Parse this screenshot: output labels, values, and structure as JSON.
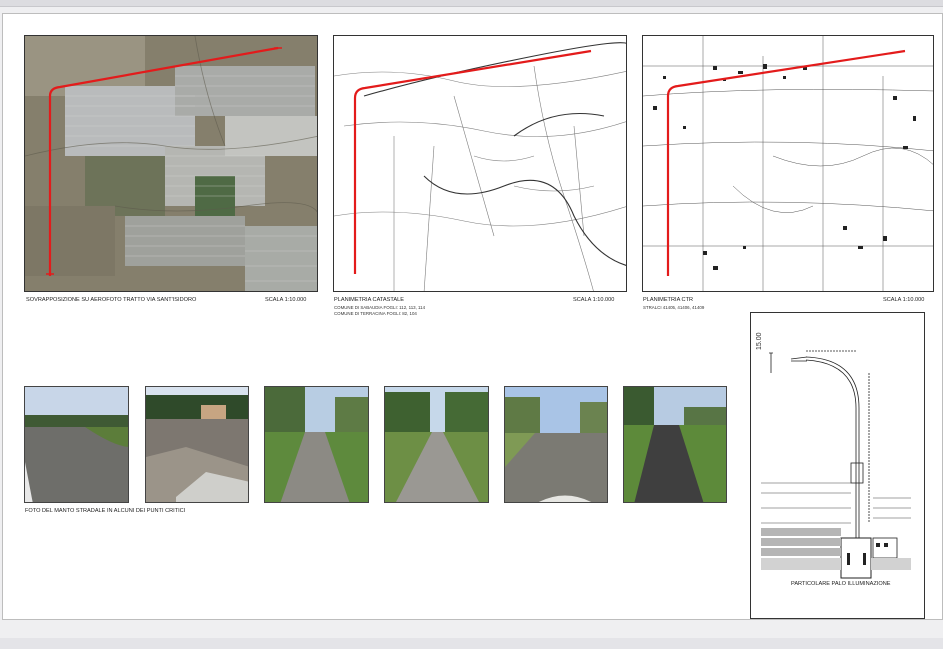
{
  "panels": {
    "aerial": {
      "caption": "SOVRAPPOSIZIONE SU AEROFOTO TRATTO VIA SANT'ISIDORO",
      "scale": "SCALA 1:10.000"
    },
    "cadastral": {
      "caption": "PLANIMETRIA CATASTALE",
      "scale": "SCALA 1:10.000",
      "sub_lines": [
        "COMUNE DI SABAUDIA FOGLI: 112, 113, 114",
        "COMUNE DI TERRACINA FOGLI: 82, 104"
      ]
    },
    "ctr": {
      "caption": "PLANIMETRIA CTR",
      "scale": "SCALA 1:10.000",
      "sub_lines": [
        "STRALCI 41405, 41406, 41409"
      ]
    }
  },
  "photos": {
    "caption": "FOTO DEL MANTO STRADALE IN ALCUNI DEI PUNTI CRITICI",
    "items": [
      "photo-1",
      "photo-2",
      "photo-3",
      "photo-4",
      "photo-5",
      "photo-6"
    ]
  },
  "detail": {
    "caption": "PARTICOLARE PALO ILLUMINAZIONE",
    "height_label": "15.00"
  },
  "colors": {
    "route": "#e31b1b",
    "frame": "#333333"
  }
}
